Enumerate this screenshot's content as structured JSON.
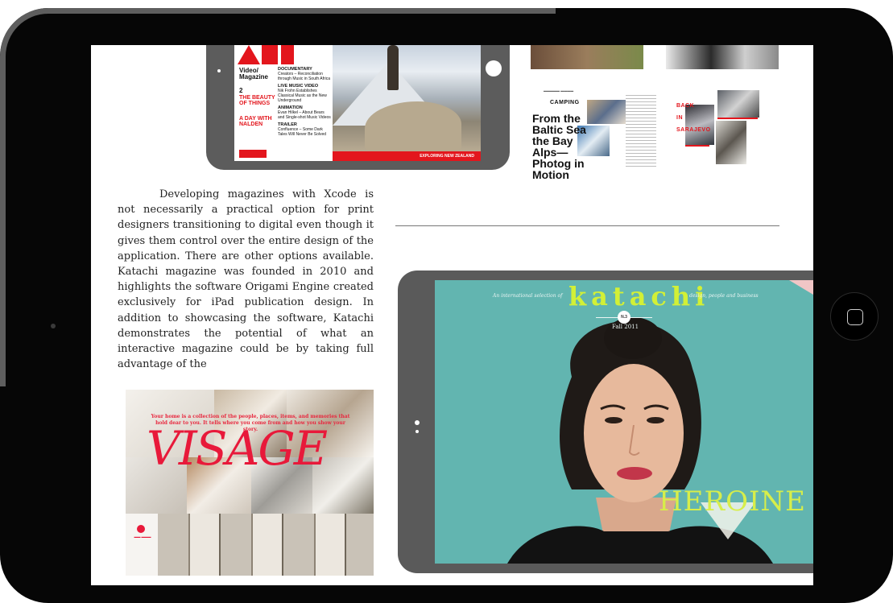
{
  "article": {
    "paragraph": "Developing magazines with Xcode is not necessarily a practical option for print designers transitioning to digital even though it gives them control over the entire design of the application. There are other options available. Katachi magazine was founded in 2010 and highlights the software Origami Engine created exclusively for iPad publication design. In addition to showcasing the software, Katachi demonstrates the potential of what an interactive magazine could be by taking full advantage of the"
  },
  "ant_magazine": {
    "title": "Video/ Magazine",
    "issue_number": "2",
    "headline_1": "THE BEAUTY OF THINGS",
    "headline_2": "A DAY WITH NALDEN",
    "sections": [
      {
        "label": "DOCUMENTARY",
        "desc": "Creators – Reconciliation through Music in South Africa"
      },
      {
        "label": "LIVE MUSIC VIDEO",
        "desc": "Nik Frohn Establishes Classical Music as the New Underground"
      },
      {
        "label": "ANIMATION",
        "desc": "Evan Hilkel – About Bears and Single-shot Music Videos"
      },
      {
        "label": "TRAILER",
        "desc": "Confluence – Some Dark Tales Will Never Be Solved"
      }
    ],
    "footer": "EXPLORING NEW ZEALAND"
  },
  "camping_spread": {
    "section": "CAMPING",
    "headline": "From the Baltic Sea the Bay Alps— Photog in Motion"
  },
  "sarajevo_spread": {
    "title": "BACK IN SARAJEVO"
  },
  "visage_spread": {
    "tagline": "Your home is a collection of the people, places, items, and memories that hold dear to you. It tells where you come from and how you show your story.",
    "title": "VISAGE"
  },
  "katachi_cover": {
    "intro": "An international selection of",
    "logo": "katachi",
    "outro": "design, people and business",
    "issue": "N.3",
    "season": "Fall 2011",
    "feature": "HEROINE"
  },
  "colors": {
    "device_frame": "#060606",
    "ant_red": "#e3161d",
    "visage_red": "#e8193a",
    "katachi_teal": "#62b5b0",
    "katachi_lime": "#d2f036"
  },
  "icons": {
    "home_button": "home-square-icon",
    "camera": "front-camera-icon"
  }
}
